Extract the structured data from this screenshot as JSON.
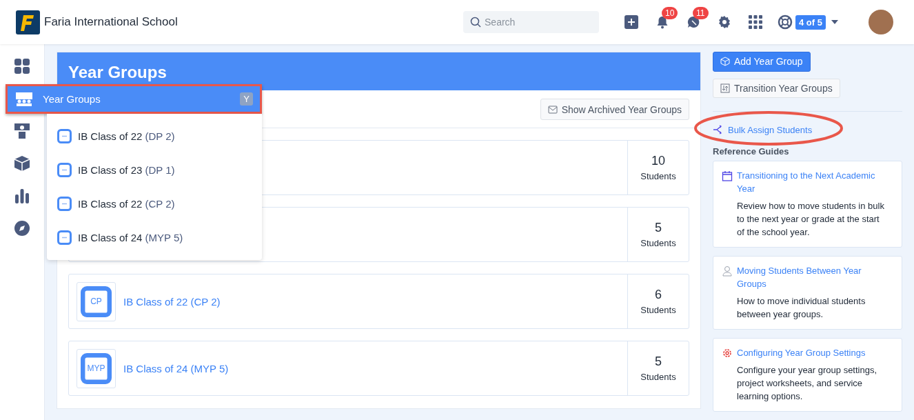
{
  "header": {
    "school_name": "Faria International School",
    "search": {
      "placeholder": "Search"
    },
    "notifications_badge": "10",
    "messages_badge": "11",
    "help_badge": "4 of 5"
  },
  "nav_menu": {
    "title": "Year Groups",
    "shortcut": "Y",
    "highlighted": true,
    "items": [
      {
        "label": "IB Class of 22",
        "program": "(DP 2)"
      },
      {
        "label": "IB Class of 23",
        "program": "(DP 1)"
      },
      {
        "label": "IB Class of 22",
        "program": "(CP 2)"
      },
      {
        "label": "IB Class of 24",
        "program": "(MYP 5)"
      }
    ]
  },
  "page": {
    "title": "Year Groups",
    "archived_button": "Show Archived Year Groups",
    "rows": [
      {
        "count": "10",
        "unit": "Students"
      },
      {
        "count": "5",
        "unit": "Students"
      },
      {
        "icon_label": "CP",
        "name": "IB Class of 22 (CP 2)",
        "count": "6",
        "unit": "Students"
      },
      {
        "icon_label": "MYP",
        "name": "IB Class of 24 (MYP 5)",
        "count": "5",
        "unit": "Students"
      }
    ]
  },
  "actions": {
    "add_button": "Add Year Group",
    "transition_button": "Transition Year Groups",
    "bulk_assign": {
      "label": "Bulk Assign Students",
      "highlighted": true
    }
  },
  "reference_guides": {
    "title": "Reference Guides",
    "guides": [
      {
        "kind": "calendar",
        "title": "Transitioning to the Next Academic Year",
        "description": "Review how to move students in bulk to the next year or grade at the start of the school year."
      },
      {
        "kind": "person",
        "title": "Moving Students Between Year Groups",
        "description": "How to move individual students between year groups."
      },
      {
        "kind": "gear",
        "title": "Configuring Year Group Settings",
        "description": "Configure your year group settings, project worksheets, and service learning options."
      }
    ]
  }
}
